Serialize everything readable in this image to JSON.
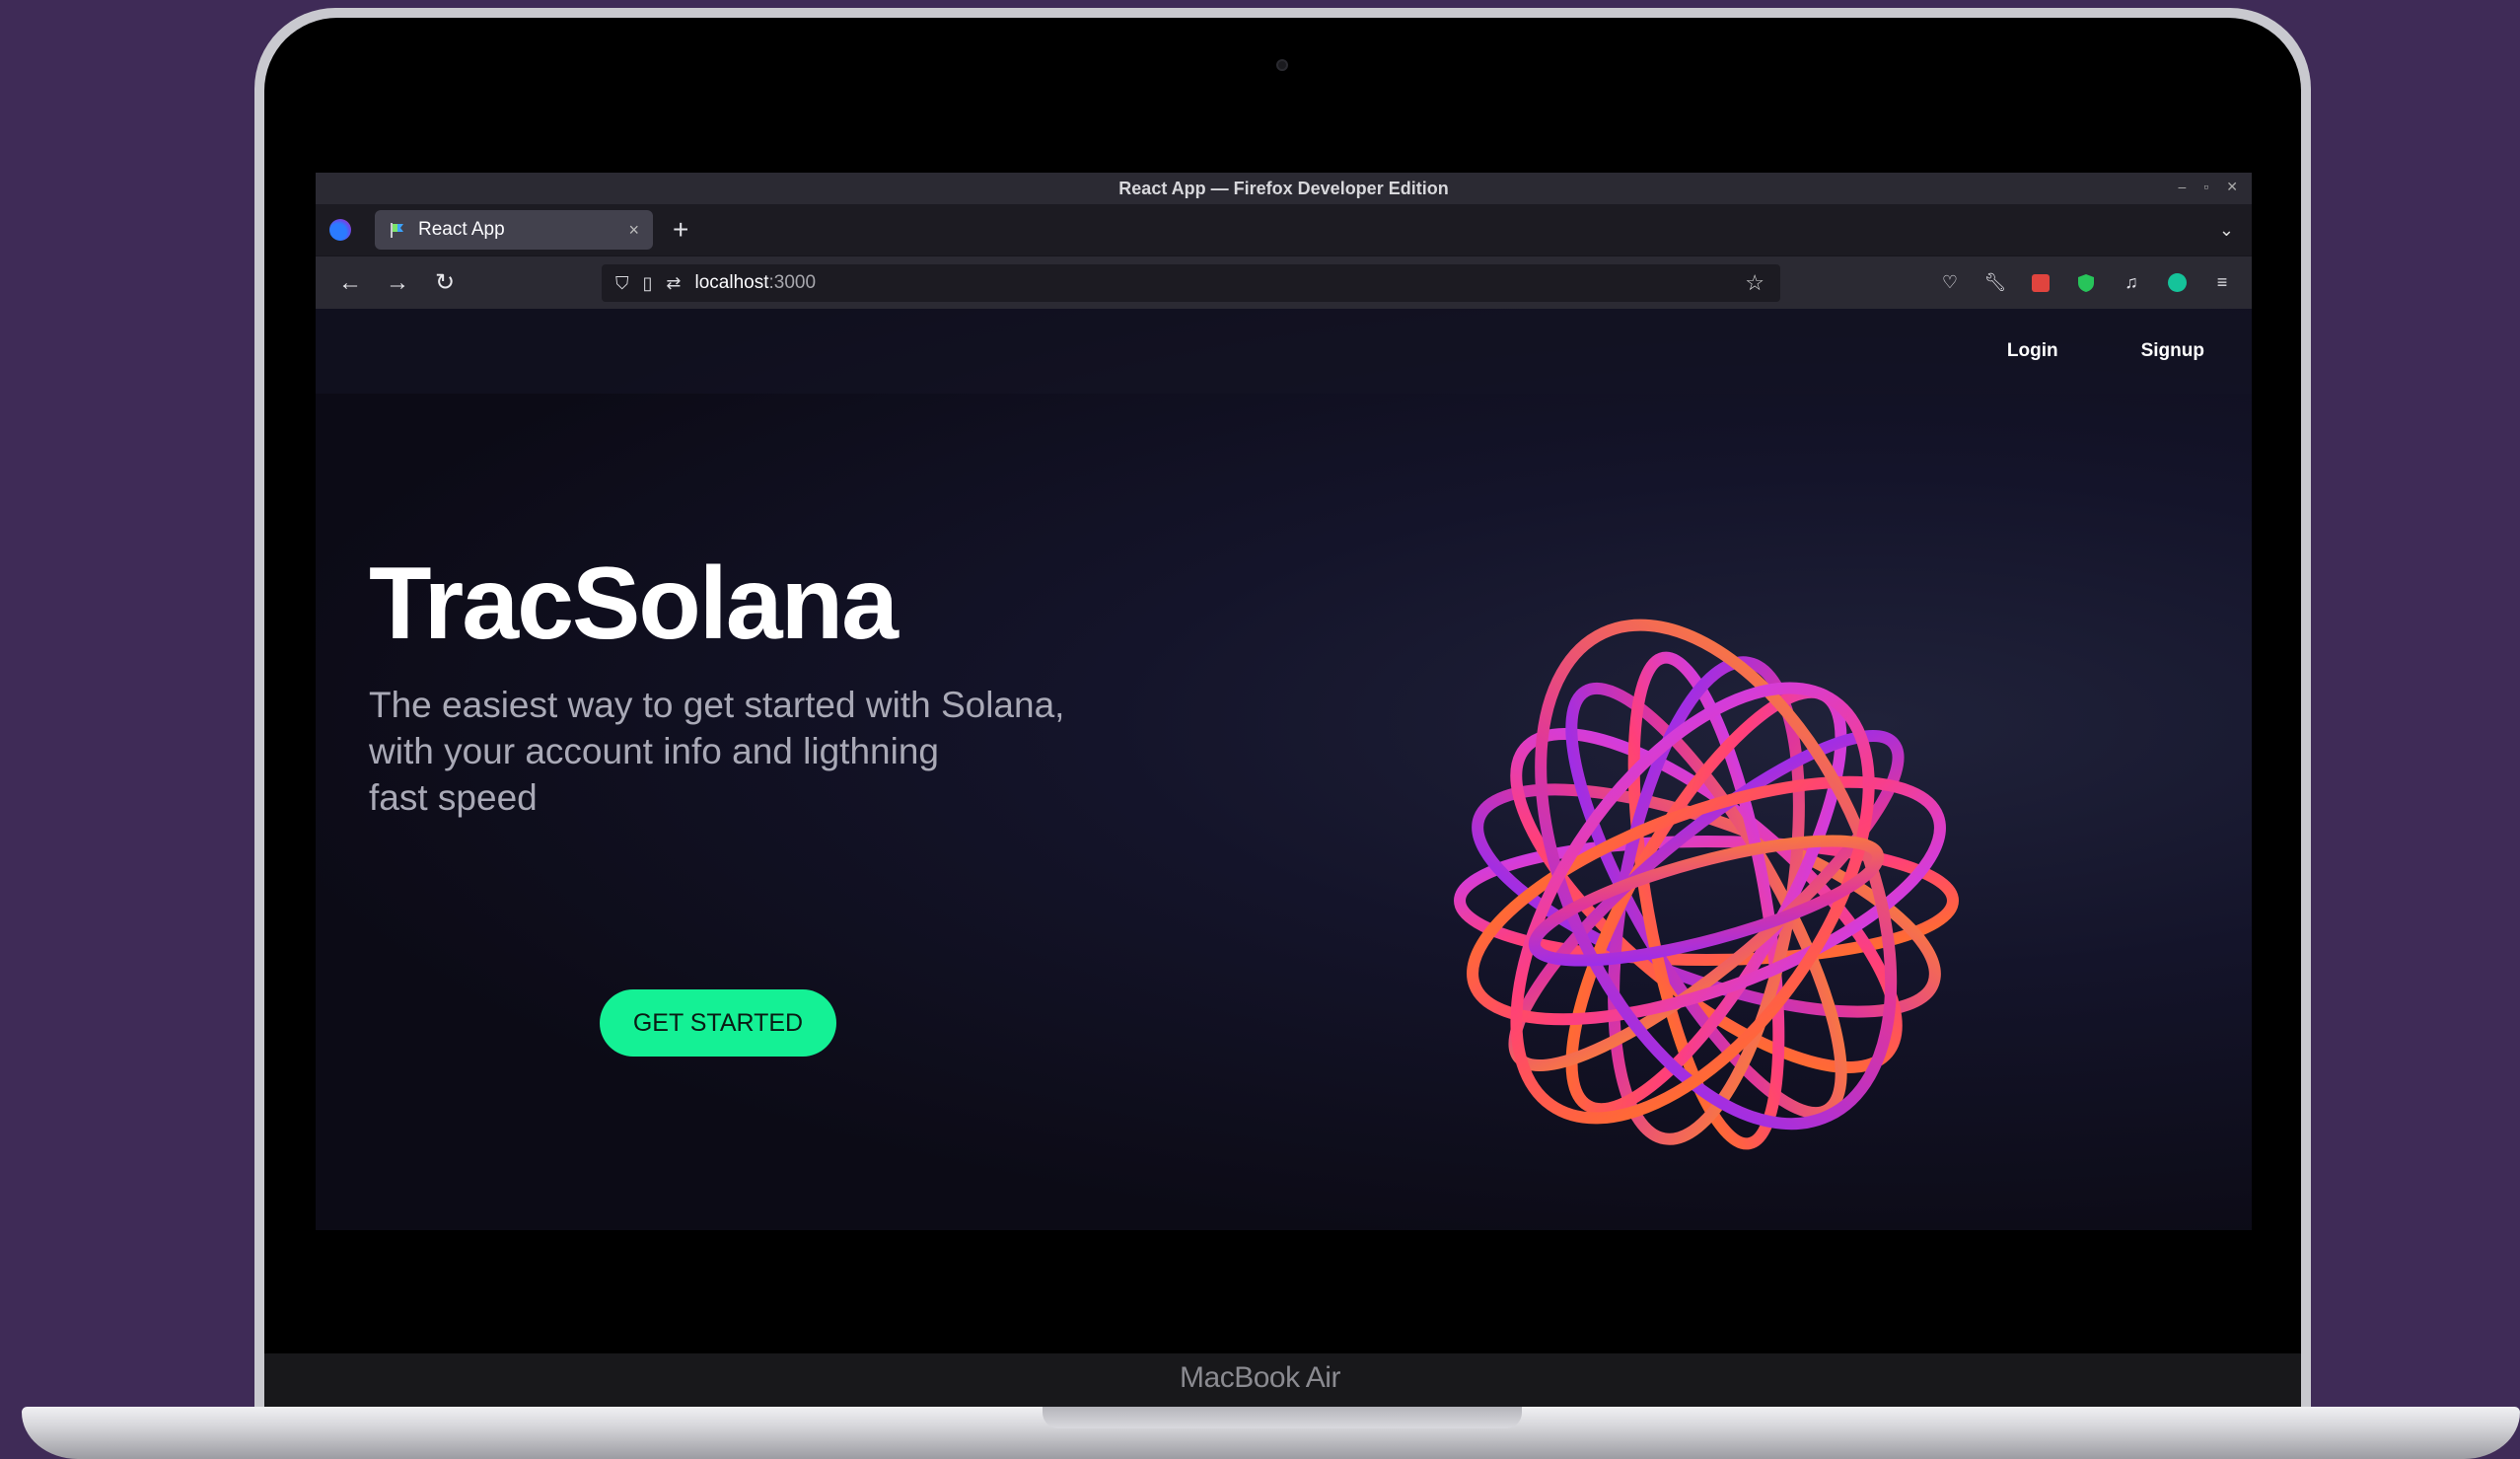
{
  "device": {
    "model_label": "MacBook Air"
  },
  "window": {
    "title": "React App — Firefox Developer Edition"
  },
  "tabs": [
    {
      "label": "React App",
      "close": "×"
    }
  ],
  "tabbar": {
    "new_tab": "+",
    "list": "⌄"
  },
  "urlbar": {
    "host": "localhost",
    "port": ":3000"
  },
  "page": {
    "nav": {
      "login": "Login",
      "signup": "Signup"
    },
    "hero": {
      "title": "TracSolana",
      "subtitle_line1": "The easiest way to get started with Solana,",
      "subtitle_line2": "with your account info and ligthning",
      "subtitle_line3": "fast speed",
      "cta": "GET STARTED"
    },
    "colors": {
      "accent": "#14f195",
      "background": "#0e0d18"
    }
  },
  "icons": [
    "firefox-logo-icon",
    "back-icon",
    "forward-icon",
    "reload-icon",
    "shield-icon",
    "page-icon",
    "permissions-icon",
    "star-icon",
    "pocket-icon",
    "wrench-icon",
    "extension-red-icon",
    "extension-green-shield-icon",
    "music-icon",
    "grammarly-icon",
    "menu-icon"
  ]
}
